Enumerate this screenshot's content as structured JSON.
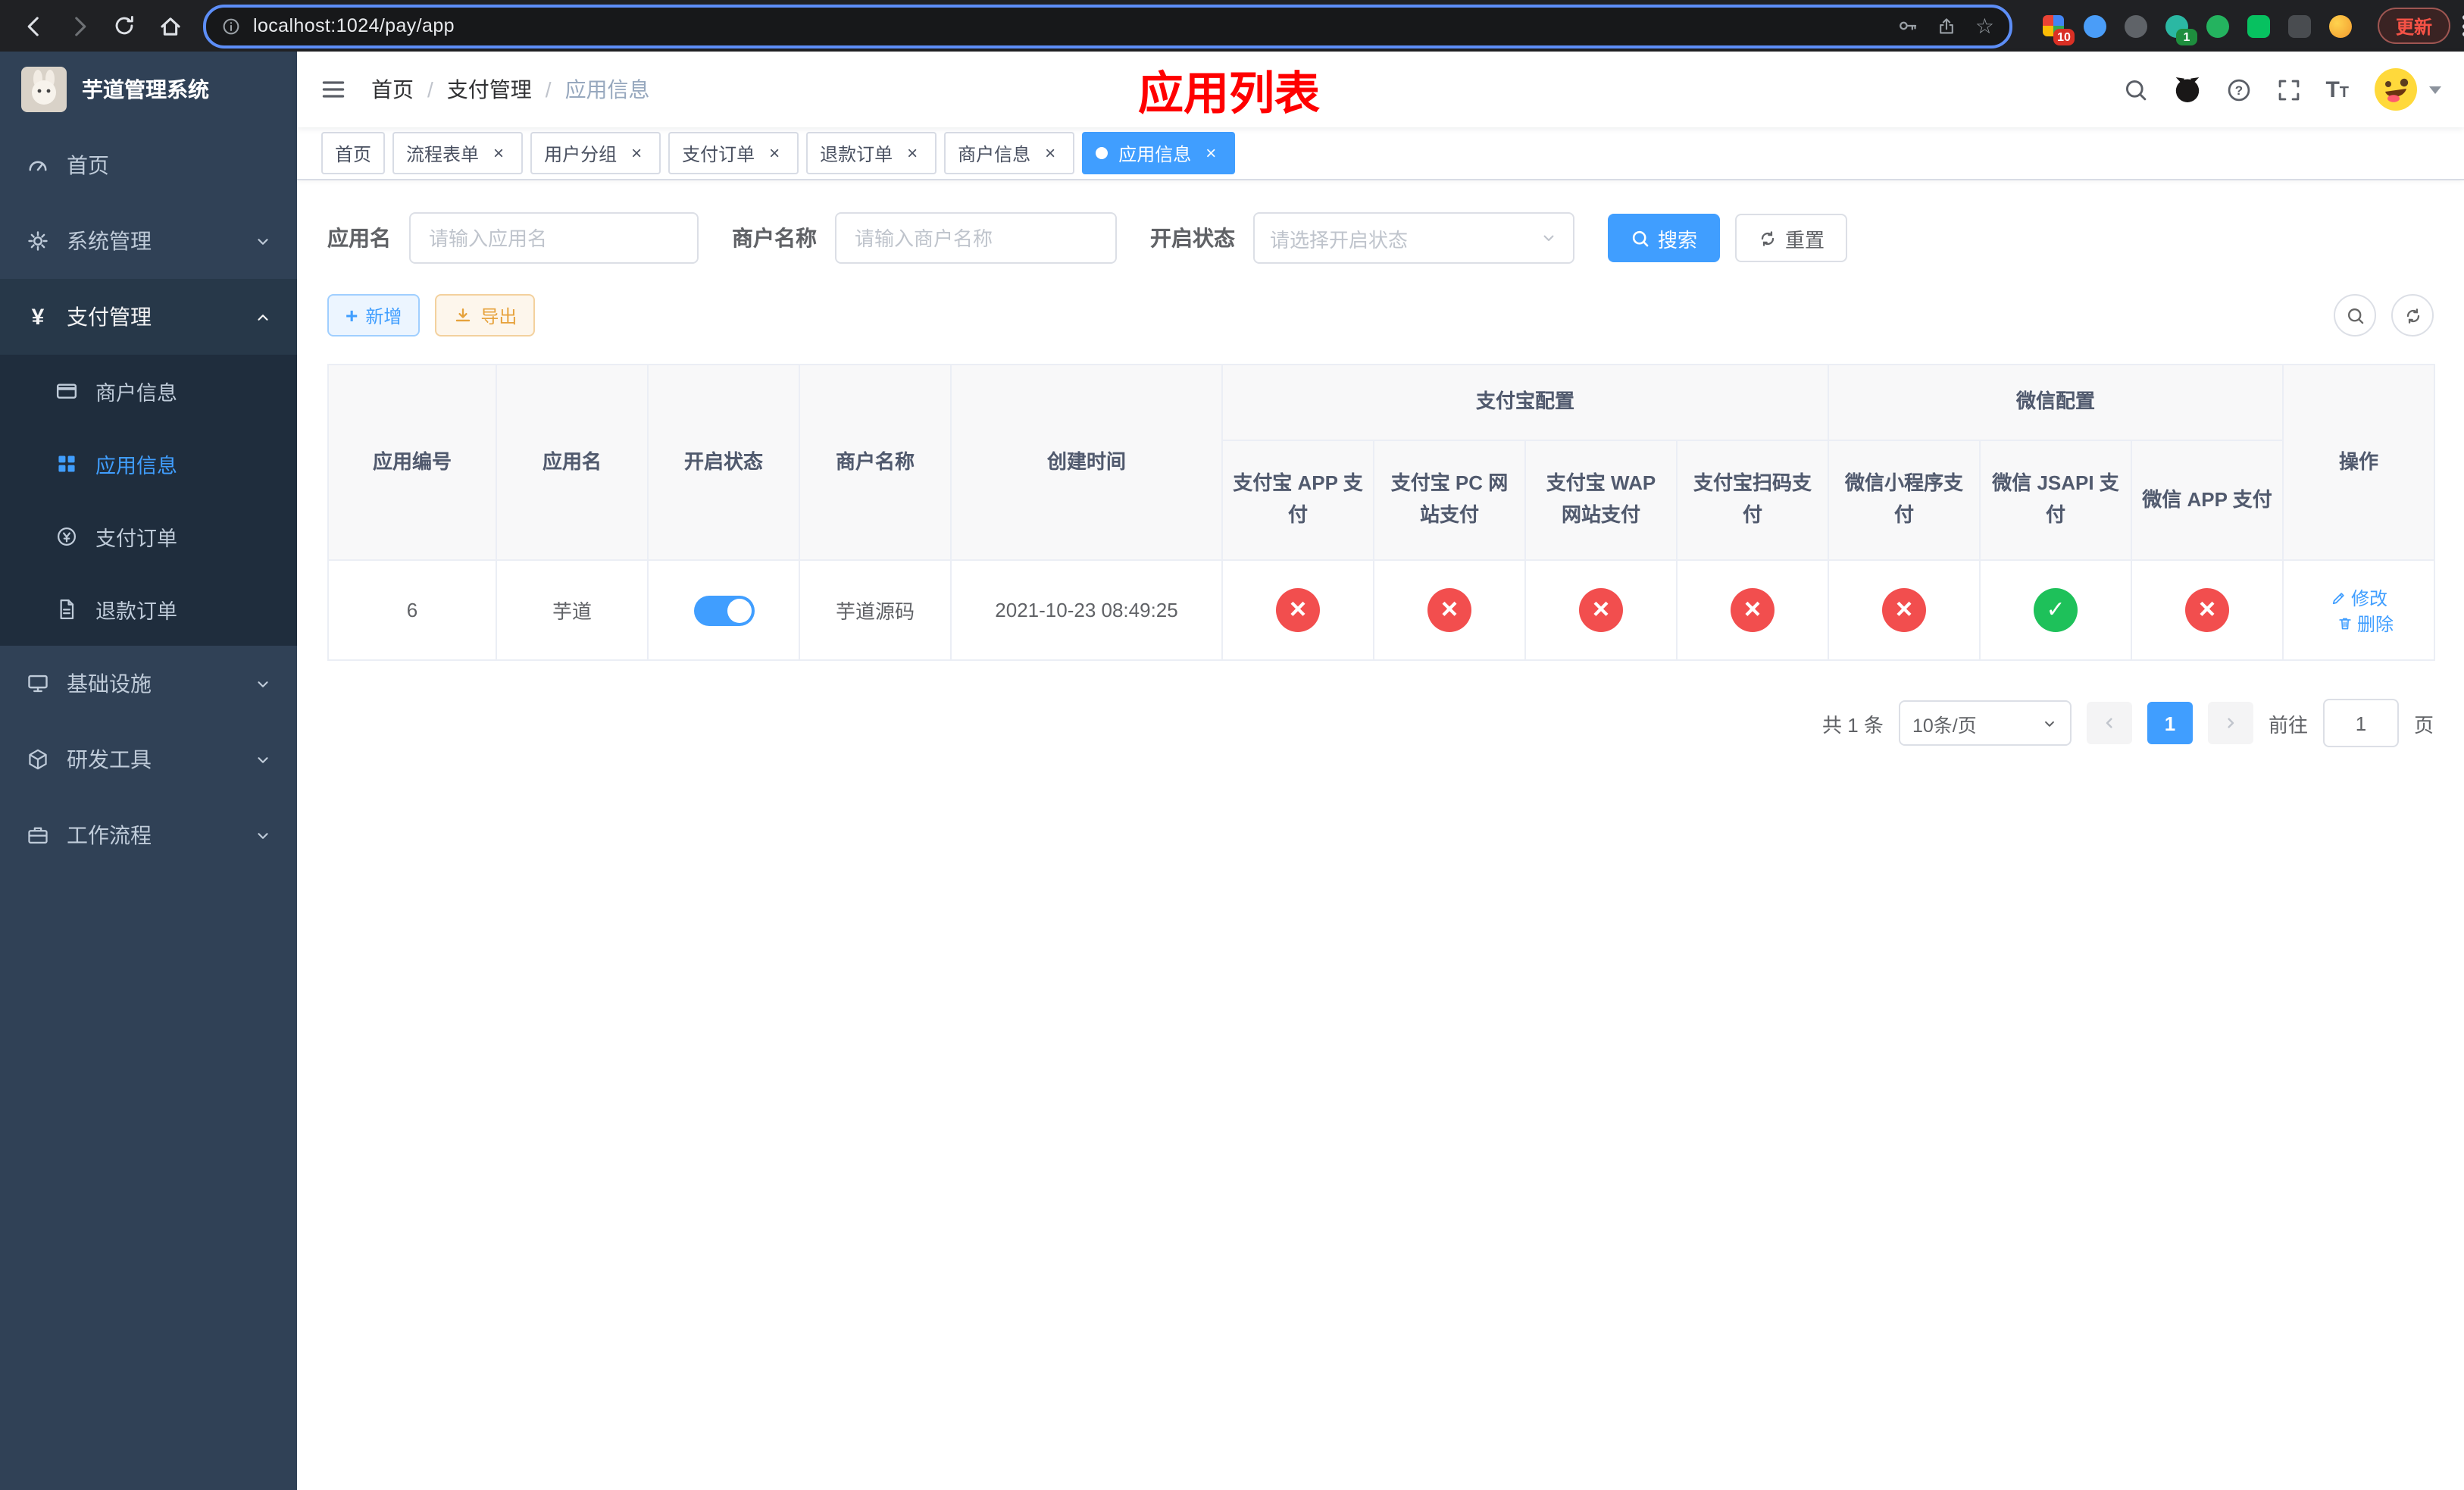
{
  "colors": {
    "primary": "#409eff",
    "danger": "#f24e4e",
    "success": "#1ec15a",
    "title_red": "#ff0000"
  },
  "browser": {
    "url": "localhost:1024/pay/app",
    "update_label": "更新",
    "ext_badge_grid": "10",
    "ext_badge_avatar": "1"
  },
  "sidebar": {
    "title": "芋道管理系统",
    "menu": {
      "home": "首页",
      "system": "系统管理",
      "pay": "支付管理",
      "merchant": "商户信息",
      "app": "应用信息",
      "order": "支付订单",
      "refund": "退款订单",
      "infra": "基础设施",
      "dev": "研发工具",
      "flow": "工作流程"
    }
  },
  "navbar": {
    "crumb1": "首页",
    "crumb2": "支付管理",
    "crumb3": "应用信息",
    "sep": "/",
    "page_title": "应用列表"
  },
  "tags": {
    "t0": "首页",
    "t1": "流程表单",
    "t2": "用户分组",
    "t3": "支付订单",
    "t4": "退款订单",
    "t5": "商户信息",
    "t6": "应用信息"
  },
  "filters": {
    "app_name_label": "应用名",
    "app_name_placeholder": "请输入应用名",
    "merchant_label": "商户名称",
    "merchant_placeholder": "请输入商户名称",
    "status_label": "开启状态",
    "status_placeholder": "请选择开启状态",
    "search_label": "搜索",
    "reset_label": "重置"
  },
  "toolbar": {
    "add_label": "新增",
    "export_label": "导出"
  },
  "table": {
    "group_alipay": "支付宝配置",
    "group_wechat": "微信配置",
    "headers": {
      "id": "应用编号",
      "name": "应用名",
      "status": "开启状态",
      "merchant": "商户名称",
      "created": "创建时间",
      "alipay_app": "支付宝 APP 支付",
      "alipay_pc": "支付宝 PC 网站支付",
      "alipay_wap": "支付宝 WAP 网站支付",
      "alipay_qr": "支付宝扫码支付",
      "wx_mini": "微信小程序支付",
      "wx_jsapi": "微信 JSAPI 支付",
      "wx_app": "微信 APP 支付",
      "actions": "操作"
    },
    "row": {
      "id": "6",
      "name": "芋道",
      "status_on": true,
      "merchant": "芋道源码",
      "created": "2021-10-23 08:49:25",
      "configs": [
        "no",
        "no",
        "no",
        "no",
        "no",
        "yes",
        "no"
      ],
      "edit_label": "修改",
      "delete_label": "删除"
    }
  },
  "pagination": {
    "total": "共 1 条",
    "page_size": "10条/页",
    "current_page": "1",
    "goto_label": "前往",
    "goto_value": "1",
    "page_suffix": "页"
  }
}
